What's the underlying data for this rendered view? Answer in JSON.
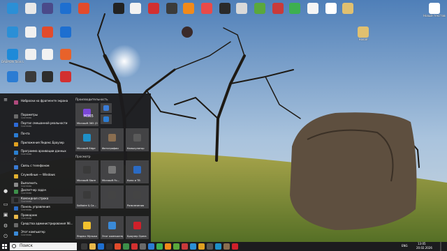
{
  "desktop": {
    "icons_top": [
      {
        "id": "di-1",
        "label": ""
      },
      {
        "id": "di-2",
        "label": ""
      },
      {
        "id": "di-3",
        "label": ""
      },
      {
        "id": "di-4",
        "label": ""
      },
      {
        "id": "di-5",
        "label": ""
      },
      {
        "id": "di-6",
        "label": ""
      },
      {
        "id": "di-7",
        "label": ""
      },
      {
        "id": "di-8",
        "label": ""
      },
      {
        "id": "di-9",
        "label": ""
      },
      {
        "id": "di-10",
        "label": ""
      },
      {
        "id": "di-11",
        "label": ""
      },
      {
        "id": "di-12",
        "label": ""
      },
      {
        "id": "di-13",
        "label": ""
      },
      {
        "id": "di-14",
        "label": ""
      },
      {
        "id": "di-15",
        "label": ""
      },
      {
        "id": "di-16",
        "label": ""
      },
      {
        "id": "di-17",
        "label": ""
      },
      {
        "id": "di-18",
        "label": ""
      },
      {
        "id": "di-19",
        "label": ""
      }
    ],
    "left_labels": [
      "DAEMON Tools Lite"
    ],
    "right_icon_labels": [
      "Новый текстовый документ",
      "Новая"
    ],
    "icon_colors": [
      "#2b8fd6",
      "#e8e8e8",
      "#4a4a8a",
      "#1e6fd0",
      "#e24b2b",
      "#222222",
      "#f2f2f2",
      "#d23030",
      "#3b3b3b",
      "#f28a1a",
      "#e84a4a",
      "#2a2a2a",
      "#d9d9d9",
      "#5aa83c",
      "#c93a3a",
      "#3db050",
      "#f5f5f5",
      "#ffffff",
      "#e0c070"
    ]
  },
  "start_menu": {
    "app_list": [
      {
        "name": "Наброски на фрагменте экрана",
        "sub": "",
        "color": "#b04a7d"
      },
      {
        "name": "Параметры",
        "sub": "Система",
        "color": "#6a6a6a"
      },
      {
        "name": "Портал смешанной реальности",
        "sub": "Система",
        "color": "#2d6ad6"
      },
      {
        "name": "Почта",
        "sub": "",
        "color": "#2b7cd3"
      },
      {
        "name": "Приложения Яндекс.Браузер",
        "sub": "",
        "color": "#e0a020"
      },
      {
        "name": "Программа архивации данных",
        "sub": "Система",
        "color": "#2a7fd0"
      },
      {
        "name": "Связь с телефоном",
        "sub": "",
        "color": "#3a7bd5"
      },
      {
        "name": "Служебные — Windows",
        "sub": "",
        "color": "#e0b030"
      },
      {
        "name": "Выполнить",
        "sub": "Система",
        "color": "#8a8a8a"
      },
      {
        "name": "Диспетчер задач",
        "sub": "Система",
        "color": "#3d8f4a"
      },
      {
        "name": "Командная строка",
        "sub": "Система",
        "color": "#222222"
      },
      {
        "name": "Панель управления",
        "sub": "Система",
        "color": "#2b6bc4"
      },
      {
        "name": "Проводник",
        "sub": "Система",
        "color": "#e8b84a"
      },
      {
        "name": "Средства администрирования Wi...",
        "sub": "",
        "color": "#6a6a6a"
      },
      {
        "name": "Этот компьютер",
        "sub": "Система",
        "color": "#3a8ad8"
      }
    ],
    "letter_c": "С",
    "groups": [
      "Производительность",
      "Просмотр"
    ],
    "tiles": [
      {
        "label": "",
        "color": "#7b47d9"
      },
      {
        "label": "",
        "color": "#3b7dd8"
      },
      {
        "label": "",
        "color": "#2b7cd3"
      },
      {
        "label": "Microsoft Edge",
        "color": "#1e90c8"
      },
      {
        "label": "Фотографии",
        "color": "#8a6e50"
      },
      {
        "label": "Калькулятор",
        "color": "#5a5a5a"
      },
      {
        "label": "Microsoft Store",
        "color": "#3a3a3a"
      },
      {
        "label": "Microsoft Fo...",
        "color": "#777777"
      },
      {
        "label": "Кино и ТВ",
        "color": "#2b6bc4"
      },
      {
        "label": "Solitaire & Ca...",
        "color": "#3a3a3a"
      },
      {
        "label": "",
        "color": "#444444"
      },
      {
        "label": "Развлечения",
        "color": "#444444"
      },
      {
        "label": "Яндекс Музыка",
        "color": "#f2c12e"
      },
      {
        "label": "Этот компьютер",
        "color": "#3a8ad8"
      },
      {
        "label": "Браузер Opera",
        "color": "#d0202a"
      }
    ],
    "m365_label": "M365",
    "m365_sub": "Microsoft 365 (Office)"
  },
  "taskbar": {
    "search_placeholder": "Поиск",
    "language": "ENG",
    "time": "13:05",
    "date": "20.02.2026",
    "icon_colors": [
      "#3a3a3a",
      "#e8b84a",
      "#1e6fd0",
      "#2d2d2d",
      "#e24b2b",
      "#3d8f4a",
      "#d23030",
      "#6a6a6a",
      "#2b7cd3",
      "#3db050",
      "#f28a1a",
      "#5aa83c",
      "#c93a3a",
      "#2b8fd6",
      "#e0a020",
      "#555555",
      "#1e90c8",
      "#8a6e50",
      "#d0202a"
    ]
  }
}
